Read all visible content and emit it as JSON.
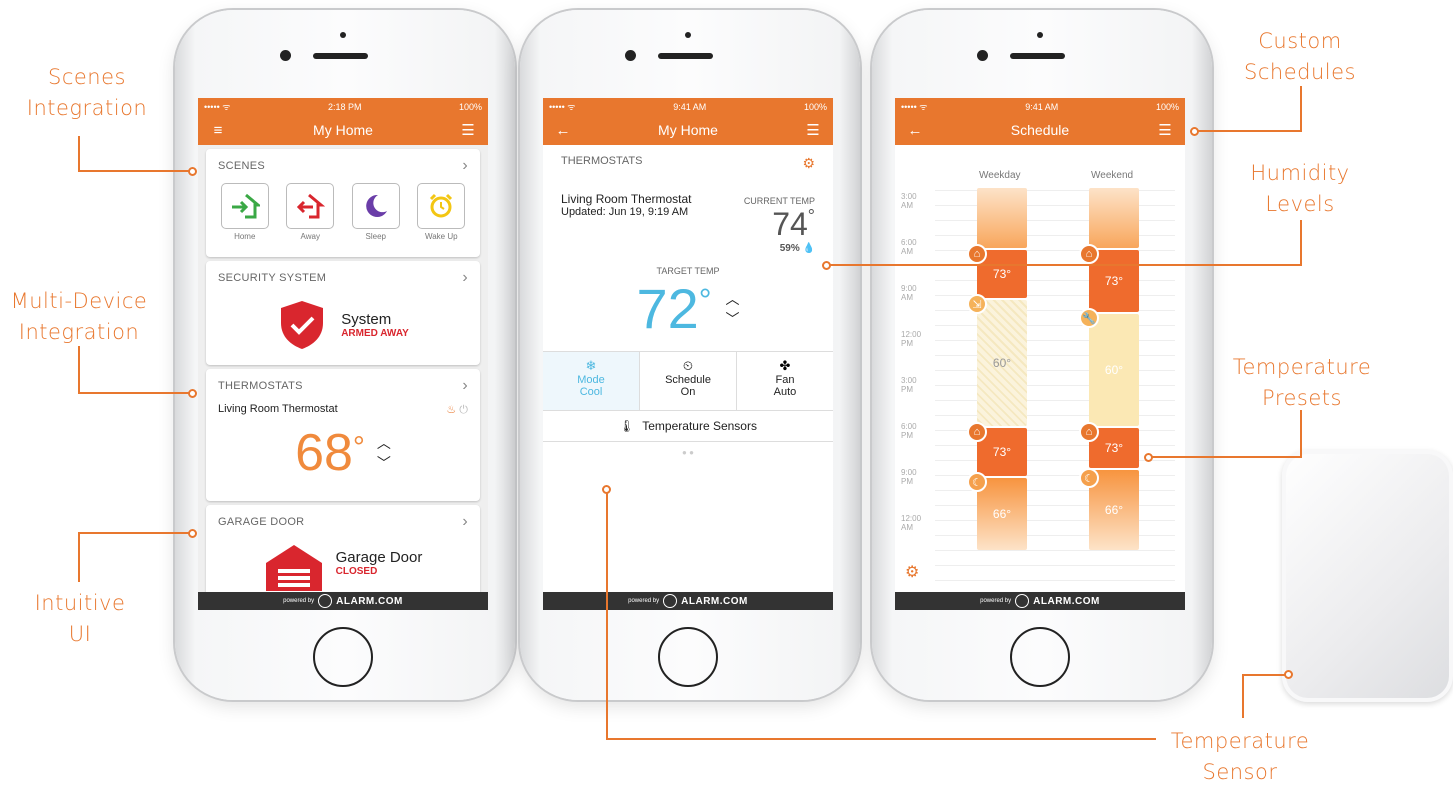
{
  "colors": {
    "accent": "#e8772e",
    "blue": "#4db8e0",
    "red": "#d9262e",
    "green": "#3aa845",
    "purple": "#6a3da8",
    "yellow": "#f3c613"
  },
  "callouts": {
    "scenes": "Scenes\nIntegration",
    "multi": "Multi-Device\nIntegration",
    "ui": "Intuitive\nUI",
    "custom": "Custom\nSchedules",
    "humidity": "Humidity\nLevels",
    "presets": "Temperature\nPresets",
    "sensor": "Temperature\nSensor"
  },
  "phone1": {
    "status_left": "••••• ᯤ",
    "time": "2:18 PM",
    "battery": "100%",
    "title": "My Home",
    "scenes_label": "SCENES",
    "scenes": [
      {
        "label": "Home",
        "icon": "home-arrive-icon"
      },
      {
        "label": "Away",
        "icon": "home-leave-icon"
      },
      {
        "label": "Sleep",
        "icon": "moon-icon"
      },
      {
        "label": "Wake Up",
        "icon": "alarm-clock-icon"
      }
    ],
    "security_label": "SECURITY SYSTEM",
    "system_name": "System",
    "system_status": "ARMED AWAY",
    "thermo_label": "THERMOSTATS",
    "thermo_name": "Living Room Thermostat",
    "thermo_temp": "68",
    "garage_label": "GARAGE DOOR",
    "garage_name": "Garage Door",
    "garage_status": "CLOSED"
  },
  "phone2": {
    "status_left": "••••• ᯤ",
    "time": "9:41 AM",
    "battery": "100%",
    "title": "My Home",
    "thermo_label": "THERMOSTATS",
    "thermo_name": "Living Room Thermostat",
    "updated": "Updated: Jun 19, 9:19 AM",
    "current_label": "CURRENT TEMP",
    "current_temp": "74",
    "humidity": "59%",
    "target_label": "TARGET TEMP",
    "target_temp": "72",
    "mode_label": "Mode",
    "mode_value": "Cool",
    "schedule_label": "Schedule",
    "schedule_value": "On",
    "fan_label": "Fan",
    "fan_value": "Auto",
    "sensors_label": "Temperature Sensors"
  },
  "phone3": {
    "status_left": "••••• ᯤ",
    "time": "9:41 AM",
    "battery": "100%",
    "title": "Schedule",
    "col1": "Weekday",
    "col2": "Weekend",
    "times": [
      [
        "3:00",
        "AM"
      ],
      [
        "6:00",
        "AM"
      ],
      [
        "9:00",
        "AM"
      ],
      [
        "12:00",
        "PM"
      ],
      [
        "3:00",
        "PM"
      ],
      [
        "6:00",
        "PM"
      ],
      [
        "9:00",
        "PM"
      ],
      [
        "12:00",
        "AM"
      ]
    ],
    "weekday": [
      "73°",
      "60°",
      "73°",
      "66°"
    ],
    "weekend": [
      "73°",
      "60°",
      "73°",
      "66°"
    ]
  },
  "footer": {
    "powered": "powered by",
    "brand": "ALARM.COM"
  }
}
